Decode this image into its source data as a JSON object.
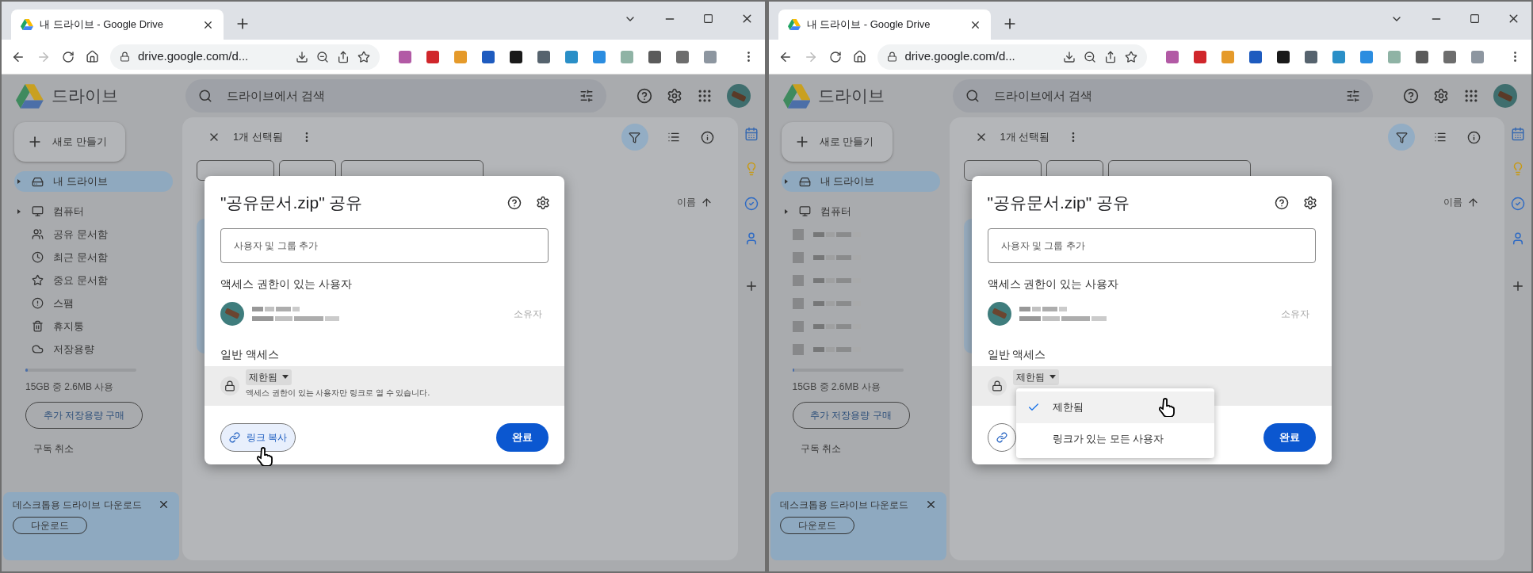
{
  "windows": [
    {
      "tab": {
        "title": "내 드라이브 - Google Drive"
      },
      "address": "drive.google.com/d...",
      "app": {
        "name": "드라이브",
        "search_placeholder": "드라이브에서 검색"
      },
      "new_button": "새로 만들기",
      "sidebar": [
        {
          "kind": "item",
          "label": "내 드라이브",
          "selected": true,
          "expandable": true
        },
        {
          "kind": "item",
          "label": "컴퓨터",
          "selected": false,
          "expandable": true
        },
        {
          "kind": "item",
          "label": "공유 문서함",
          "selected": false,
          "expandable": false
        },
        {
          "kind": "item",
          "label": "최근 문서함",
          "selected": false,
          "expandable": false
        },
        {
          "kind": "item",
          "label": "중요 문서함",
          "selected": false,
          "expandable": false
        },
        {
          "kind": "item",
          "label": "스팸",
          "selected": false,
          "expandable": false
        },
        {
          "kind": "item",
          "label": "휴지통",
          "selected": false,
          "expandable": false
        },
        {
          "kind": "item",
          "label": "저장용량",
          "selected": false,
          "expandable": false
        }
      ],
      "storage": {
        "level": 0.02,
        "usage": "15GB 중 2.6MB 사용",
        "buy": "추가 저장용량 구매",
        "cancel": "구독 취소"
      },
      "banner": {
        "text": "데스크톱용 드라이브 다운로드",
        "button": "다운로드"
      },
      "selection": "1개 선택됨",
      "sort_label": "이름",
      "dialog": {
        "title": "\"공유문서.zip\" 공유",
        "input_placeholder": "사용자 및 그룹 추가",
        "people_heading": "액세스 권한이 있는 사용자",
        "owner_role": "소유자",
        "general_heading": "일반 액세스",
        "access": "제한됨",
        "access_description": "액세스 권한이 있는 사용자만 링크로 열 수 있습니다.",
        "copy_link": {
          "label": "링크 복사",
          "hovered": true
        },
        "done": "완료"
      }
    },
    {
      "tab": {
        "title": "내 드라이브 - Google Drive"
      },
      "address": "drive.google.com/d...",
      "app": {
        "name": "드라이브",
        "search_placeholder": "드라이브에서 검색"
      },
      "new_button": "새로 만들기",
      "sidebar": [
        {
          "kind": "item",
          "label": "내 드라이브",
          "selected": true,
          "expandable": true
        },
        {
          "kind": "item",
          "label": "컴퓨터",
          "selected": false,
          "expandable": true
        },
        {
          "kind": "obscured",
          "selected": false
        },
        {
          "kind": "obscured",
          "selected": false
        },
        {
          "kind": "obscured",
          "selected": false
        },
        {
          "kind": "obscured",
          "selected": false
        },
        {
          "kind": "obscured",
          "selected": false
        },
        {
          "kind": "obscured",
          "selected": false
        }
      ],
      "storage": {
        "level": 0.02,
        "usage": "15GB 중 2.6MB 사용",
        "buy": "추가 저장용량 구매",
        "cancel": "구독 취소"
      },
      "banner": {
        "text": "데스크톱용 드라이브 다운로드",
        "button": "다운로드"
      },
      "selection": "1개 선택됨",
      "sort_label": "이름",
      "dialog": {
        "title": "\"공유문서.zip\" 공유",
        "input_placeholder": "사용자 및 그룹 추가",
        "people_heading": "액세스 권한이 있는 사용자",
        "owner_role": "소유자",
        "general_heading": "일반 액세스",
        "access": "제한됨",
        "done": "완료",
        "copy_link": {
          "hovered": false
        },
        "menu": {
          "items": [
            {
              "label": "제한됨",
              "selected": true,
              "hovered": true
            },
            {
              "label": "링크가 있는 모든 사용자",
              "selected": false,
              "hovered": false
            }
          ]
        }
      }
    }
  ]
}
